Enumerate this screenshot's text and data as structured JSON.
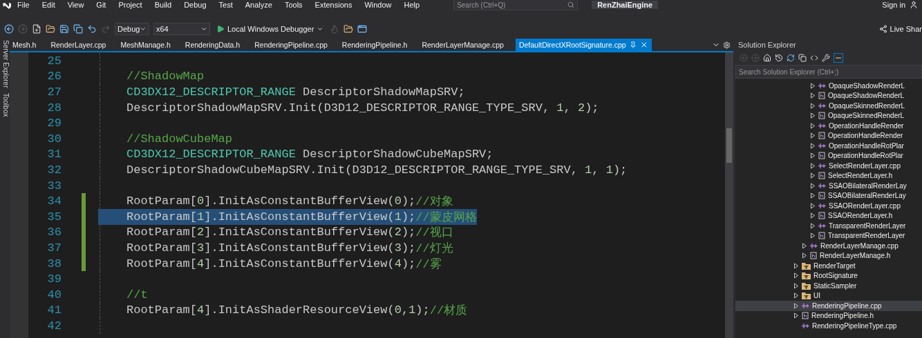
{
  "menu": [
    "File",
    "Edit",
    "View",
    "Git",
    "Project",
    "Build",
    "Debug",
    "Test",
    "Analyze",
    "Tools",
    "Extensions",
    "Window",
    "Help"
  ],
  "search": {
    "placeholder": "Search (Ctrl+Q)"
  },
  "solution_name": "RenZhaiEngine",
  "sign_in": "Sign in",
  "toolbar": {
    "configuration": "Debug",
    "platform": "x64",
    "debugger": "Local Windows Debugger",
    "live_share": "Live Shar"
  },
  "side_tabs": [
    "Server Explorer",
    "Toolbox"
  ],
  "tabs": [
    {
      "label": "Mesh.h",
      "selected": false
    },
    {
      "label": "RenderLayer.cpp",
      "selected": false
    },
    {
      "label": "MeshManage.h",
      "selected": false
    },
    {
      "label": "RenderingData.h",
      "selected": false
    },
    {
      "label": "RenderingPipeline.cpp",
      "selected": false
    },
    {
      "label": "RenderingPipeline.h",
      "selected": false
    },
    {
      "label": "RenderLayerManage.cpp",
      "selected": false
    },
    {
      "label": "DefaultDirectXRootSignature.cpp",
      "selected": true
    }
  ],
  "code_lines": [
    {
      "number": "25",
      "changed": false,
      "selected": false
    },
    {
      "number": "26",
      "changed": false,
      "selected": false,
      "tokens": [
        {
          "kind": "comment",
          "text": "//ShadowMap"
        }
      ]
    },
    {
      "number": "27",
      "changed": false,
      "selected": false,
      "tokens": [
        {
          "kind": "type",
          "text": "CD3DX12_DESCRIPTOR_RANGE"
        },
        {
          "kind": "plain",
          "text": " DescriptorShadowMapSRV;"
        }
      ]
    },
    {
      "number": "28",
      "changed": false,
      "selected": false,
      "tokens": [
        {
          "kind": "plain",
          "text": "DescriptorShadowMapSRV.Init(D3D12_DESCRIPTOR_RANGE_TYPE_SRV, "
        },
        {
          "kind": "number",
          "text": "1"
        },
        {
          "kind": "plain",
          "text": ", "
        },
        {
          "kind": "number",
          "text": "2"
        },
        {
          "kind": "plain",
          "text": ");"
        }
      ]
    },
    {
      "number": "29",
      "changed": false,
      "selected": false
    },
    {
      "number": "30",
      "changed": false,
      "selected": false,
      "tokens": [
        {
          "kind": "comment",
          "text": "//ShadowCubeMap"
        }
      ]
    },
    {
      "number": "31",
      "changed": false,
      "selected": false,
      "tokens": [
        {
          "kind": "type",
          "text": "CD3DX12_DESCRIPTOR_RANGE"
        },
        {
          "kind": "plain",
          "text": " DescriptorShadowCubeMapSRV;"
        }
      ]
    },
    {
      "number": "32",
      "changed": false,
      "selected": false,
      "tokens": [
        {
          "kind": "plain",
          "text": "DescriptorShadowCubeMapSRV.Init(D3D12_DESCRIPTOR_RANGE_TYPE_SRV, "
        },
        {
          "kind": "number",
          "text": "1"
        },
        {
          "kind": "plain",
          "text": ", "
        },
        {
          "kind": "number",
          "text": "1"
        },
        {
          "kind": "plain",
          "text": ");"
        }
      ]
    },
    {
      "number": "33",
      "changed": false,
      "selected": false
    },
    {
      "number": "34",
      "changed": true,
      "selected": false,
      "tokens": [
        {
          "kind": "plain",
          "text": "RootParam["
        },
        {
          "kind": "number",
          "text": "0"
        },
        {
          "kind": "plain",
          "text": "].InitAsConstantBufferView("
        },
        {
          "kind": "number",
          "text": "0"
        },
        {
          "kind": "plain",
          "text": ");"
        },
        {
          "kind": "comment",
          "text": "//对象"
        }
      ]
    },
    {
      "number": "35",
      "changed": true,
      "selected": true,
      "tokens": [
        {
          "kind": "plain",
          "text": "RootParam["
        },
        {
          "kind": "number",
          "text": "1"
        },
        {
          "kind": "plain",
          "text": "].InitAsConstantBufferView("
        },
        {
          "kind": "number",
          "text": "1"
        },
        {
          "kind": "plain",
          "text": ");"
        },
        {
          "kind": "comment",
          "text": "//蒙皮网格"
        }
      ]
    },
    {
      "number": "36",
      "changed": true,
      "selected": false,
      "tokens": [
        {
          "kind": "plain",
          "text": "RootParam["
        },
        {
          "kind": "number",
          "text": "2"
        },
        {
          "kind": "plain",
          "text": "].InitAsConstantBufferView("
        },
        {
          "kind": "number",
          "text": "2"
        },
        {
          "kind": "plain",
          "text": ");"
        },
        {
          "kind": "comment",
          "text": "//视口"
        }
      ]
    },
    {
      "number": "37",
      "changed": true,
      "selected": false,
      "tokens": [
        {
          "kind": "plain",
          "text": "RootParam["
        },
        {
          "kind": "number",
          "text": "3"
        },
        {
          "kind": "plain",
          "text": "].InitAsConstantBufferView("
        },
        {
          "kind": "number",
          "text": "3"
        },
        {
          "kind": "plain",
          "text": ");"
        },
        {
          "kind": "comment",
          "text": "//灯光"
        }
      ]
    },
    {
      "number": "38",
      "changed": true,
      "selected": false,
      "tokens": [
        {
          "kind": "plain",
          "text": "RootParam["
        },
        {
          "kind": "number",
          "text": "4"
        },
        {
          "kind": "plain",
          "text": "].InitAsConstantBufferView("
        },
        {
          "kind": "number",
          "text": "4"
        },
        {
          "kind": "plain",
          "text": ");"
        },
        {
          "kind": "comment",
          "text": "//雾"
        }
      ]
    },
    {
      "number": "39",
      "changed": false,
      "selected": false
    },
    {
      "number": "40",
      "changed": false,
      "selected": false,
      "tokens": [
        {
          "kind": "comment",
          "text": "//t"
        }
      ]
    },
    {
      "number": "41",
      "changed": false,
      "selected": false,
      "tokens": [
        {
          "kind": "plain",
          "text": "RootParam["
        },
        {
          "kind": "number",
          "text": "4"
        },
        {
          "kind": "plain",
          "text": "].InitAsShaderResourceView("
        },
        {
          "kind": "number",
          "text": "0"
        },
        {
          "kind": "plain",
          "text": ","
        },
        {
          "kind": "number",
          "text": "1"
        },
        {
          "kind": "plain",
          "text": ");"
        },
        {
          "kind": "comment",
          "text": "//材质"
        }
      ]
    },
    {
      "number": "42",
      "changed": false,
      "selected": false
    }
  ],
  "solution_explorer": {
    "title": "Solution Explorer",
    "search_placeholder": "Search Solution Explorer (Ctrl+;)",
    "tree": [
      {
        "children": [
          {
            "children": [
              {
                "label": "OpaqueShadowRenderL",
                "kind": "cpp",
                "expandable": true,
                "selected": false
              },
              {
                "label": "OpaqueShadowRenderL",
                "kind": "h",
                "expandable": true,
                "selected": false
              },
              {
                "label": "OpaqueSkinnedRenderL",
                "kind": "cpp",
                "expandable": true,
                "selected": false
              },
              {
                "label": "OpaqueSkinnedRenderL",
                "kind": "h",
                "expandable": true,
                "selected": false
              },
              {
                "label": "OperationHandleRender",
                "kind": "cpp",
                "expandable": true,
                "selected": false
              },
              {
                "label": "OperationHandleRender",
                "kind": "h",
                "expandable": true,
                "selected": false
              },
              {
                "label": "OperationHandleRotPlar",
                "kind": "cpp",
                "expandable": true,
                "selected": false
              },
              {
                "label": "OperationHandleRotPlar",
                "kind": "h",
                "expandable": true,
                "selected": false
              },
              {
                "label": "SelectRenderLayer.cpp",
                "kind": "cpp",
                "expandable": true,
                "selected": false
              },
              {
                "label": "SelectRenderLayer.h",
                "kind": "h",
                "expandable": true,
                "selected": false
              },
              {
                "label": "SSAOBilateralRenderLay",
                "kind": "cpp",
                "expandable": true,
                "selected": false
              },
              {
                "label": "SSAOBilateralRenderLay",
                "kind": "h",
                "expandable": true,
                "selected": false
              },
              {
                "label": "SSAORenderLayer.cpp",
                "kind": "cpp",
                "expandable": true,
                "selected": false
              },
              {
                "label": "SSAORenderLayer.h",
                "kind": "h",
                "expandable": true,
                "selected": false
              },
              {
                "label": "TransparentRenderLayer",
                "kind": "cpp",
                "expandable": true,
                "selected": false
              },
              {
                "label": "TransparentRenderLayer",
                "kind": "h",
                "expandable": true,
                "selected": false
              }
            ]
          },
          {
            "label": "RenderLayerManage.cpp",
            "kind": "cpp",
            "expandable": true,
            "selected": false
          },
          {
            "label": "RenderLayerManage.h",
            "kind": "h",
            "expandable": true,
            "selected": false
          }
        ]
      },
      {
        "label": "RenderTarget",
        "kind": "folder",
        "expandable": true,
        "selected": false
      },
      {
        "label": "RootSignature",
        "kind": "folder",
        "expandable": true,
        "selected": false
      },
      {
        "label": "StaticSampler",
        "kind": "folder",
        "expandable": true,
        "selected": false
      },
      {
        "label": "UI",
        "kind": "folder",
        "expandable": true,
        "selected": false
      },
      {
        "label": "RenderingPipeline.cpp",
        "kind": "cpp",
        "expandable": true,
        "selected": true
      },
      {
        "label": "RenderingPipeline.h",
        "kind": "h",
        "expandable": true,
        "selected": false
      },
      {
        "label": "RenderingPipelineType.cpp",
        "kind": "cpp",
        "expandable": false,
        "selected": false
      }
    ]
  }
}
